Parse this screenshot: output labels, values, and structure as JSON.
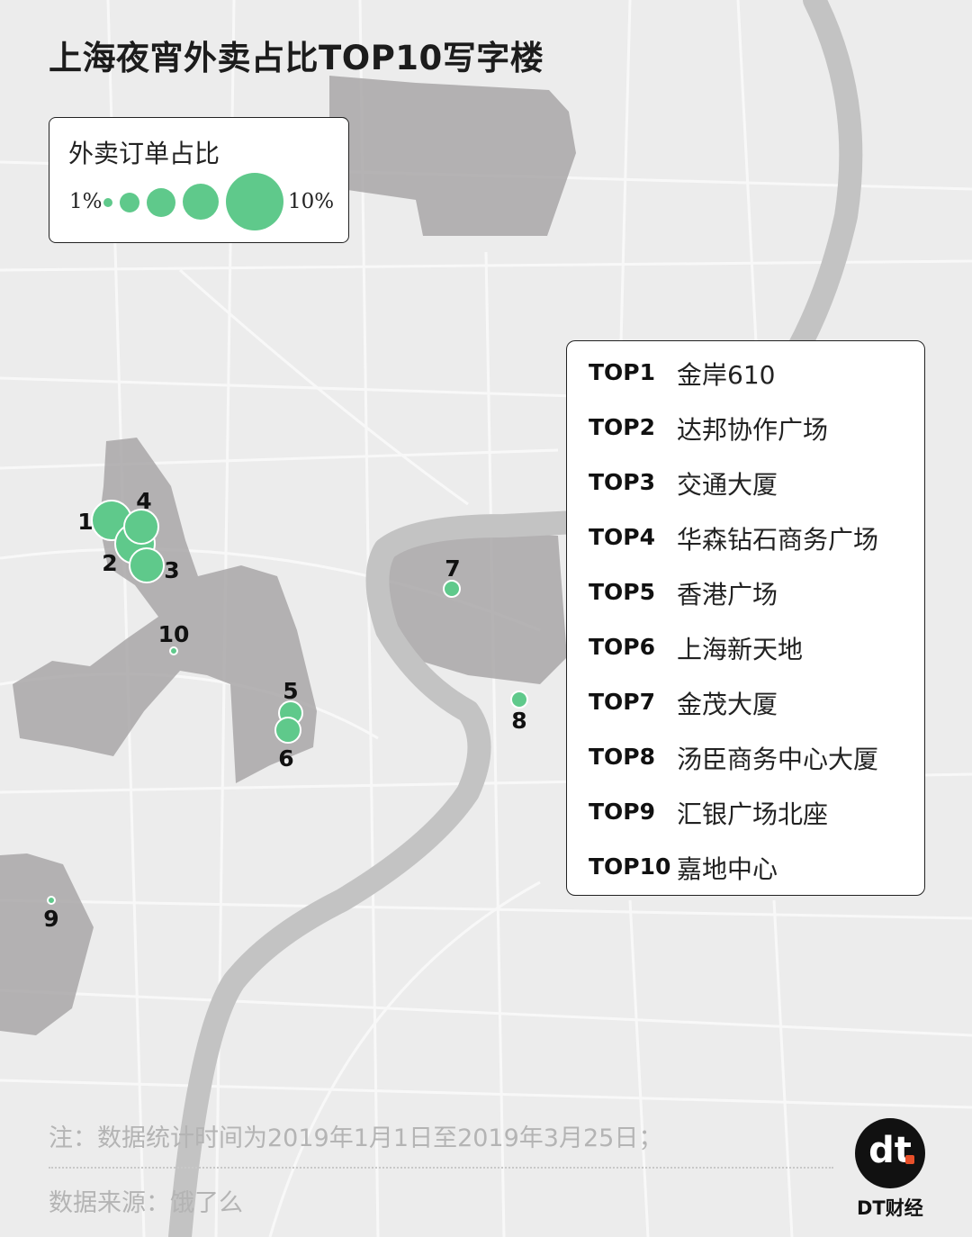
{
  "title": "上海夜宵外卖占比TOP10写字楼",
  "legend": {
    "title": "外卖订单占比",
    "min_label": "1%",
    "max_label": "10%"
  },
  "colors": {
    "bubble": "#5fc98b",
    "bubble_stroke": "#ffffff",
    "district": "#a9a7a8",
    "river": "#c5c5c5",
    "background": "#ececec",
    "logo_accent": "#e8502a"
  },
  "ranking": [
    {
      "rank": "TOP1",
      "name": "金岸610"
    },
    {
      "rank": "TOP2",
      "name": "达邦协作广场"
    },
    {
      "rank": "TOP3",
      "name": "交通大厦"
    },
    {
      "rank": "TOP4",
      "name": "华森钻石商务广场"
    },
    {
      "rank": "TOP5",
      "name": "香港广场"
    },
    {
      "rank": "TOP6",
      "name": "上海新天地"
    },
    {
      "rank": "TOP7",
      "name": "金茂大厦"
    },
    {
      "rank": "TOP8",
      "name": "汤臣商务中心大厦"
    },
    {
      "rank": "TOP9",
      "name": "汇银广场北座"
    },
    {
      "rank": "TOP10",
      "name": "嘉地中心"
    }
  ],
  "markers": [
    {
      "label": "1"
    },
    {
      "label": "2"
    },
    {
      "label": "3"
    },
    {
      "label": "4"
    },
    {
      "label": "5"
    },
    {
      "label": "6"
    },
    {
      "label": "7"
    },
    {
      "label": "8"
    },
    {
      "label": "9"
    },
    {
      "label": "10"
    }
  ],
  "notes": {
    "line1": "注：数据统计时间为2019年1月1日至2019年3月25日；",
    "line2": "数据来源：饿了么"
  },
  "logo": {
    "mark": "dt",
    "text": "DT财经"
  }
}
